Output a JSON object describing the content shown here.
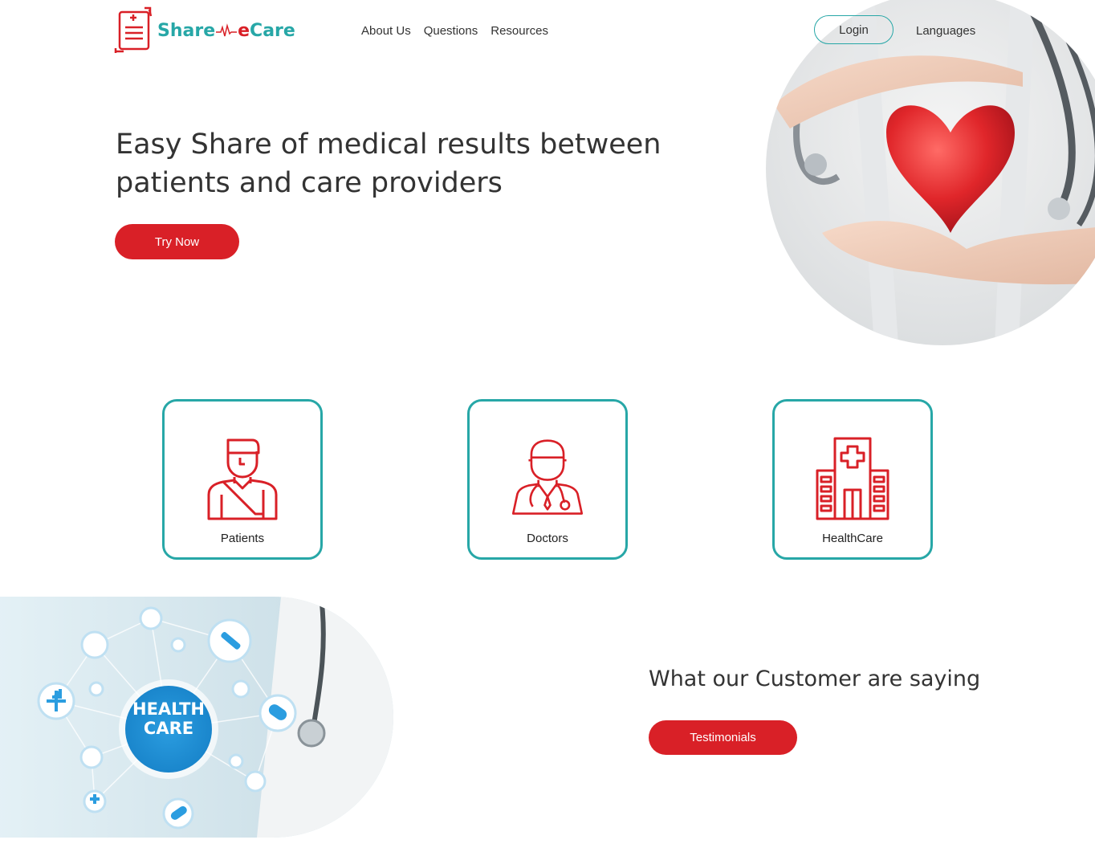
{
  "brand": {
    "name_part1": "Share",
    "name_part2": "e",
    "name_part3": "Care"
  },
  "nav": {
    "items": [
      {
        "label": "About Us"
      },
      {
        "label": "Questions"
      },
      {
        "label": "Resources"
      }
    ]
  },
  "header": {
    "login_label": "Login",
    "languages_label": "Languages"
  },
  "hero": {
    "title": "Easy Share of medical results between patients and care providers",
    "cta_label": "Try Now"
  },
  "cards": [
    {
      "label": "Patients",
      "icon": "patient-icon"
    },
    {
      "label": "Doctors",
      "icon": "doctor-icon"
    },
    {
      "label": "HealthCare",
      "icon": "hospital-icon"
    }
  ],
  "health_care_image": {
    "line1": "HEALTH",
    "line2": "CARE"
  },
  "testimonials": {
    "title": "What our Customer are saying",
    "button_label": "Testimonials"
  },
  "colors": {
    "accent_teal": "#27a7a7",
    "accent_red": "#d92027",
    "text": "#333333"
  }
}
